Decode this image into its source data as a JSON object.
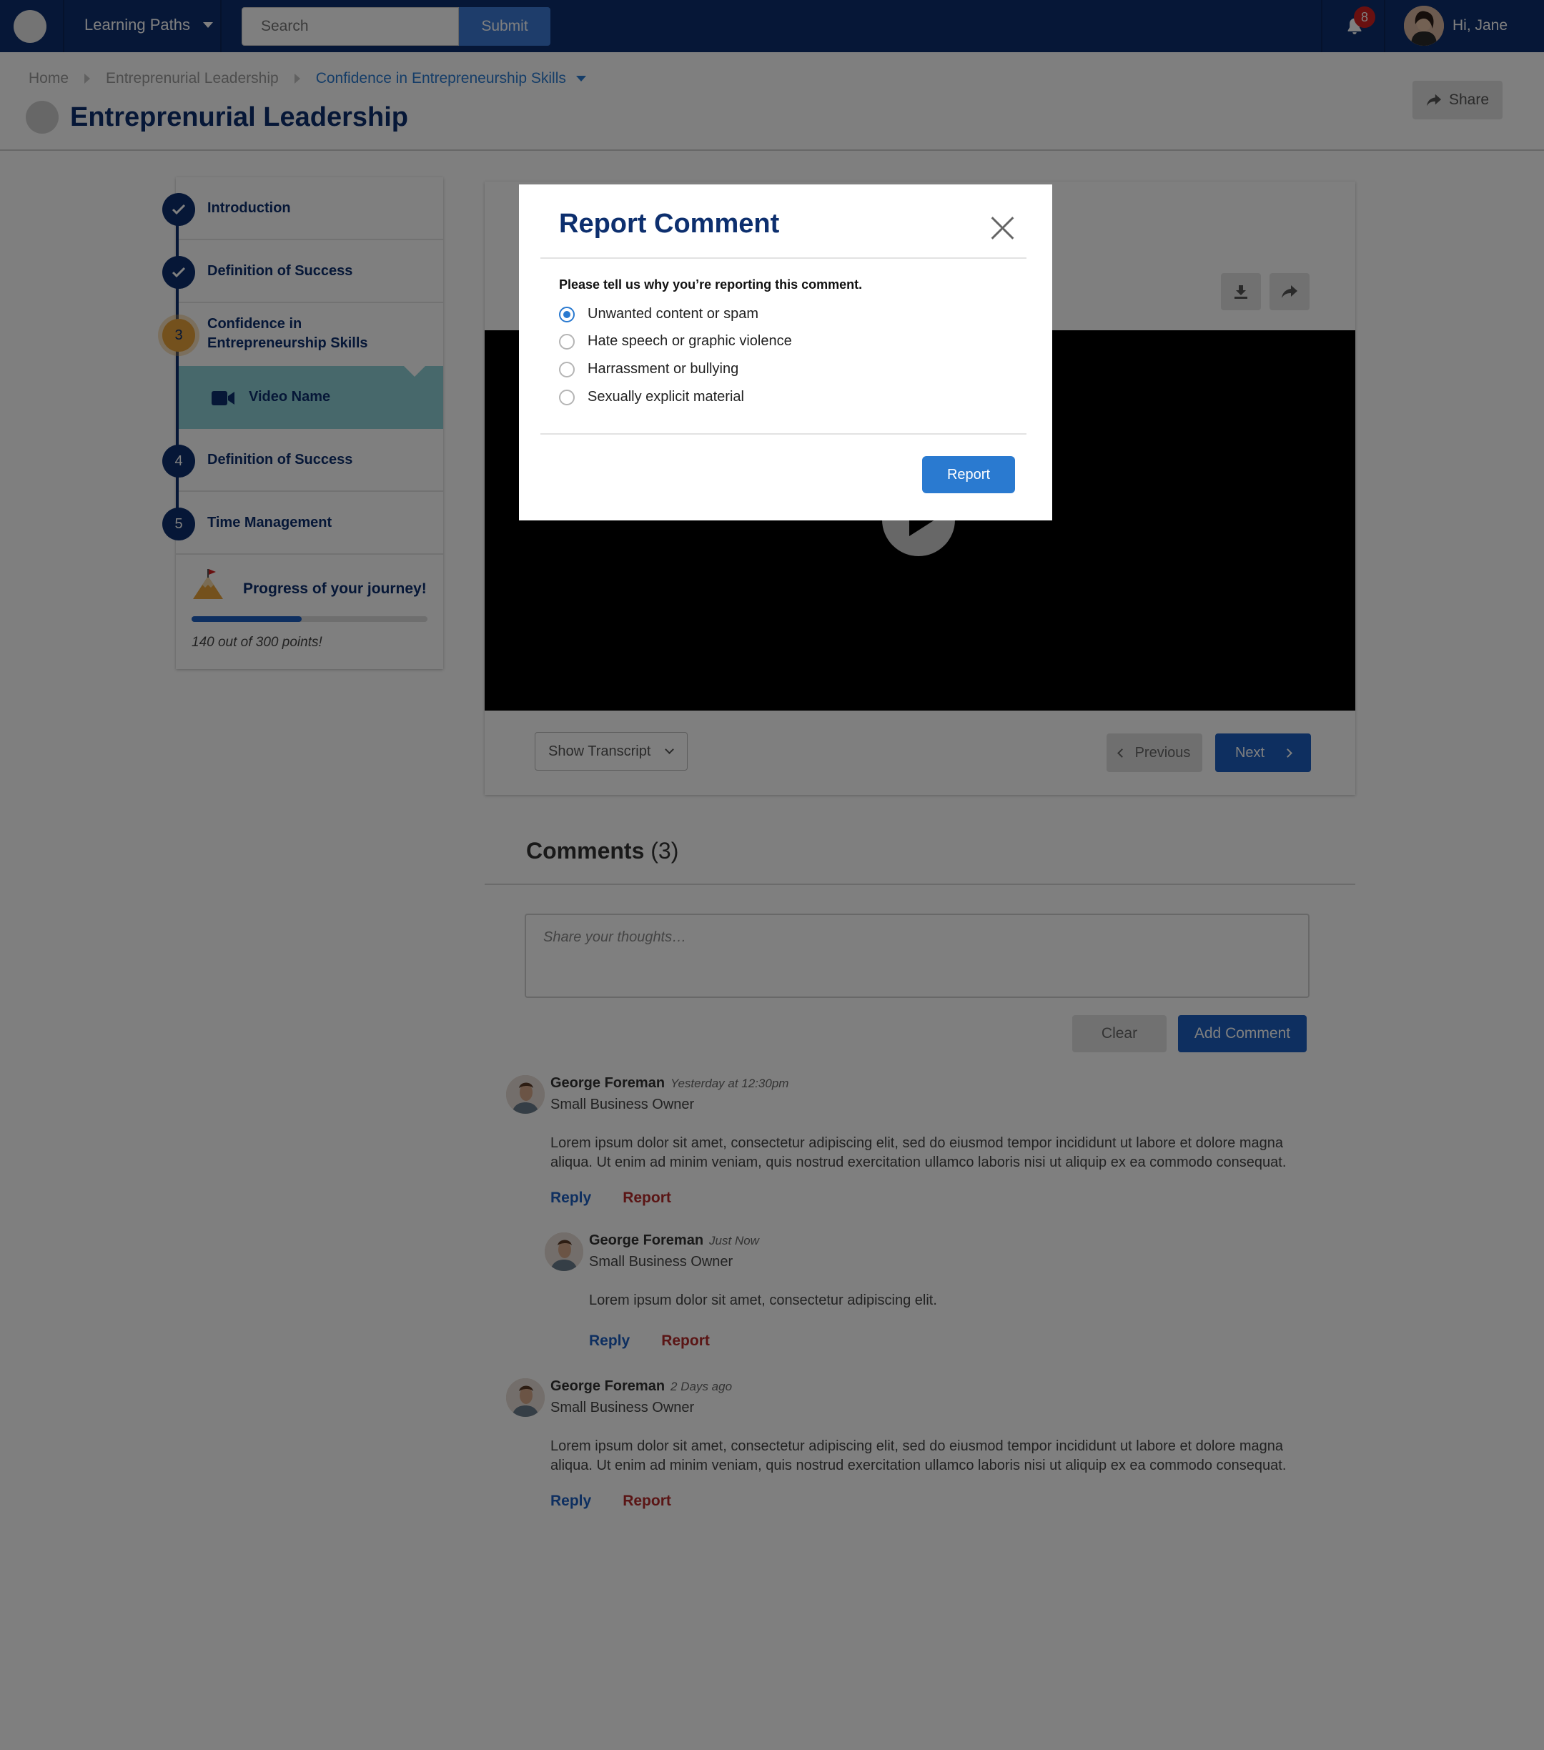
{
  "topbar": {
    "nav_label": "Learning Paths",
    "search_placeholder": "Search",
    "submit_label": "Submit",
    "notifications_count": "8",
    "greeting": "Hi, Jane"
  },
  "breadcrumb": {
    "items": [
      "Home",
      "Entreprenurial Leadership"
    ],
    "current": "Confidence in Entrepreneurship Skills"
  },
  "page": {
    "title": "Entreprenurial Leadership",
    "share_label": "Share"
  },
  "sidebar": {
    "steps": [
      {
        "marker": "✓",
        "label": "Introduction"
      },
      {
        "marker": "✓",
        "label": "Definition of Success"
      },
      {
        "marker": "3",
        "label": "Confidence in Entrepreneurship Skills"
      },
      {
        "marker": "4",
        "label": "Definition of Success"
      },
      {
        "marker": "5",
        "label": "Time Management"
      }
    ],
    "sub_item": "Video Name",
    "progress_title": "Progress of your journey!",
    "progress_text": "140 out of 300 points!",
    "progress_fraction": 0.4667
  },
  "video": {
    "transcript_label": "Show Transcript",
    "previous_label": "Previous",
    "next_label": "Next"
  },
  "comments": {
    "title": "Comments",
    "count": "(3)",
    "placeholder": "Share your thoughts…",
    "clear_label": "Clear",
    "add_label": "Add Comment",
    "items": [
      {
        "name": "George Foreman",
        "time": "Yesterday at 12:30pm",
        "role": "Small Business Owner",
        "body": "Lorem ipsum dolor sit amet, consectetur adipiscing elit, sed do eiusmod tempor incididunt ut labore et dolore magna aliqua. Ut enim ad minim veniam, quis nostrud exercitation ullamco laboris nisi ut aliquip ex ea commodo consequat.",
        "reply": "Reply",
        "report": "Report"
      },
      {
        "name": "George Foreman",
        "time": "Just Now",
        "role": "Small Business Owner",
        "body": "Lorem ipsum dolor sit amet, consectetur adipiscing elit.",
        "reply": "Reply",
        "report": "Report"
      },
      {
        "name": "George Foreman",
        "time": "2 Days ago",
        "role": "Small Business Owner",
        "body": "Lorem ipsum dolor sit amet, consectetur adipiscing elit, sed do eiusmod tempor incididunt ut labore et dolore magna aliqua. Ut enim ad minim veniam, quis nostrud exercitation ullamco laboris nisi ut aliquip ex ea commodo consequat.",
        "reply": "Reply",
        "report": "Report"
      }
    ]
  },
  "modal": {
    "title": "Report Comment",
    "prompt": "Please tell us why you’re reporting this comment.",
    "options": [
      "Unwanted content or spam",
      "Hate speech or graphic violence",
      "Harrassment or bullying",
      "Sexually explicit material"
    ],
    "selected_index": 0,
    "report_label": "Report"
  },
  "colors": {
    "navy": "#0d2f6e",
    "accent_blue": "#1d5fc0",
    "link_blue": "#2a7ad0",
    "report_red": "#b52a2a",
    "active_step": "#e8a23a",
    "video_row": "#8fd0d6"
  }
}
